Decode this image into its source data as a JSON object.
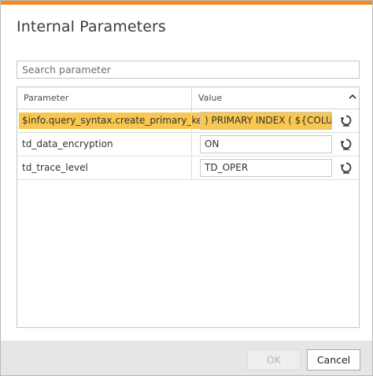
{
  "dialog": {
    "title": "Internal Parameters",
    "accent_color": "#f28b22",
    "highlight_color": "#f9c74f"
  },
  "search": {
    "placeholder": "Search parameter",
    "value": ""
  },
  "table": {
    "headers": {
      "parameter": "Parameter",
      "value": "Value"
    },
    "rows": [
      {
        "parameter": "$info.query_syntax.create_primary_key",
        "value": ") PRIMARY INDEX ( ${COLUM",
        "highlighted": true
      },
      {
        "parameter": "td_data_encryption",
        "value": "ON",
        "highlighted": false
      },
      {
        "parameter": "td_trace_level",
        "value": "TD_OPER",
        "highlighted": false
      }
    ]
  },
  "icons": {
    "collapse": "chevron-up-icon",
    "reset": "reset-icon"
  },
  "buttons": {
    "ok": "OK",
    "ok_enabled": false,
    "cancel": "Cancel"
  }
}
